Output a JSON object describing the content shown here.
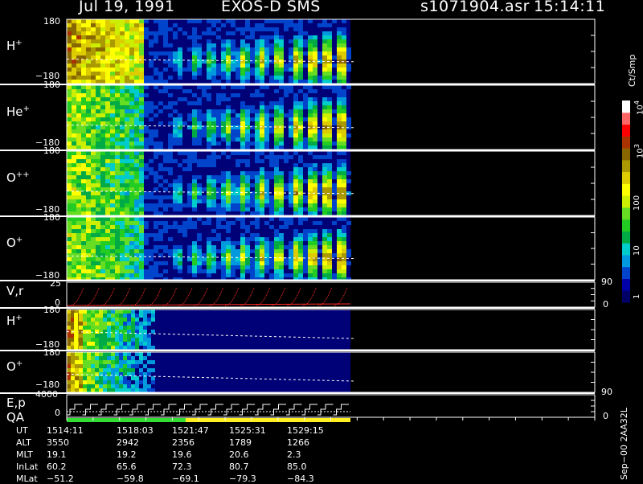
{
  "header": {
    "date": "Jul 19, 1991",
    "instrument": "EXOS-D SMS",
    "file": "s1071904.asr",
    "time": "15:14:11"
  },
  "colors": {
    "background": "#000000",
    "axis": "#ffffff",
    "velocity_trace": "#ff2a2a",
    "qa_green": "#33dd33",
    "qa_yellow": "#ffee22"
  },
  "colorbar": {
    "unit": "Ct/Smp",
    "ticks": [
      "1",
      "10",
      "100",
      "10",
      "3",
      "10",
      "4"
    ],
    "tick_labels": [
      {
        "base": "1",
        "exp": ""
      },
      {
        "base": "10",
        "exp": ""
      },
      {
        "base": "100",
        "exp": ""
      },
      {
        "base": "10",
        "exp": "3"
      },
      {
        "base": "10",
        "exp": "4"
      }
    ],
    "stops": [
      "#000066",
      "#0000aa",
      "#0044cc",
      "#0099dd",
      "#00cccc",
      "#00aa44",
      "#22cc22",
      "#66dd22",
      "#ccee00",
      "#ffff00",
      "#ddcc00",
      "#aa9900",
      "#886600",
      "#aa3300",
      "#ff0000",
      "#ff6666",
      "#ffffff"
    ],
    "scale": "log"
  },
  "panels": [
    {
      "label": "H",
      "sup": "+",
      "ymax": "180",
      "ymin": "−180"
    },
    {
      "label": "He",
      "sup": "+",
      "ymax": "180",
      "ymin": "−180"
    },
    {
      "label": "O",
      "sup": "++",
      "ymax": "180",
      "ymin": "−180"
    },
    {
      "label": "O",
      "sup": "+",
      "ymax": "180",
      "ymin": "−180"
    }
  ],
  "vr_panel": {
    "label": "V,r",
    "ymax": "25",
    "ymin": "0",
    "right_max": "90",
    "right_min": "0"
  },
  "low_panels": [
    {
      "label": "H",
      "sup": "+",
      "ymax": "180",
      "ymin": "−180"
    },
    {
      "label": "O",
      "sup": "+",
      "ymax": "180",
      "ymin": "−180"
    }
  ],
  "ep_panel": {
    "label": "E,p",
    "label2": "QA",
    "ymax": "4000",
    "ymin": "0",
    "right_max": "90",
    "right_min": "0"
  },
  "side_info": "Sep−00  2AA32L",
  "ephemeris": {
    "rows": [
      {
        "name": "UT",
        "values": [
          "1514:11",
          "1518:03",
          "1521:47",
          "1525:31",
          "1529:15"
        ]
      },
      {
        "name": "ALT",
        "values": [
          "3550",
          "2942",
          "2356",
          "1789",
          "1266"
        ]
      },
      {
        "name": "MLT",
        "values": [
          "19.1",
          "19.2",
          "19.6",
          "20.6",
          "2.3"
        ]
      },
      {
        "name": "InLat",
        "values": [
          "60.2",
          "65.6",
          "72.3",
          "80.7",
          "85.0"
        ]
      },
      {
        "name": "MLat",
        "values": [
          "−51.2",
          "−59.8",
          "−69.1",
          "−79.3",
          "−84.3"
        ]
      }
    ]
  },
  "chart_data": [
    {
      "type": "heatmap",
      "ylabel": "H+",
      "ylim": [
        -180,
        180
      ],
      "x": [
        "1514:11",
        "1518:03",
        "1521:47",
        "1525:31",
        "1529:15"
      ],
      "data_span": [
        "1514:11",
        "1530:10"
      ]
    },
    {
      "type": "heatmap",
      "ylabel": "He+",
      "ylim": [
        -180,
        180
      ],
      "x": [
        "1514:11",
        "1518:03",
        "1521:47",
        "1525:31",
        "1529:15"
      ]
    },
    {
      "type": "heatmap",
      "ylabel": "O++",
      "ylim": [
        -180,
        180
      ],
      "x": [
        "1514:11",
        "1518:03",
        "1521:47",
        "1525:31",
        "1529:15"
      ]
    },
    {
      "type": "heatmap",
      "ylabel": "O+",
      "ylim": [
        -180,
        180
      ],
      "x": [
        "1514:11",
        "1518:03",
        "1521:47",
        "1525:31",
        "1529:15"
      ]
    },
    {
      "type": "line",
      "ylabel": "V,r",
      "ylim": [
        0,
        25
      ],
      "y2lim": [
        0,
        90
      ],
      "cycles": 18
    },
    {
      "type": "heatmap",
      "ylabel": "H+",
      "ylim": [
        -180,
        180
      ]
    },
    {
      "type": "heatmap",
      "ylabel": "O+",
      "ylim": [
        -180,
        180
      ]
    },
    {
      "type": "line",
      "ylabel": "E,p",
      "ylim": [
        0,
        4000
      ],
      "y2lim": [
        0,
        90
      ],
      "steps": 18,
      "qa": [
        {
          "color": "green",
          "from": "1514:11",
          "to": "1522:00"
        },
        {
          "color": "yellow",
          "from": "1522:00",
          "to": "1530:10"
        }
      ]
    }
  ]
}
